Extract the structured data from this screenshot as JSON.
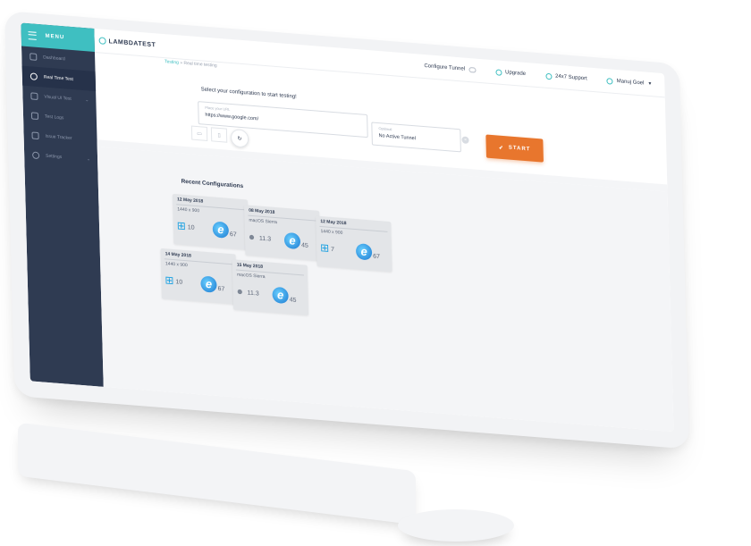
{
  "sidebar": {
    "menu_label": "MENU",
    "items": [
      {
        "label": "Dashboard"
      },
      {
        "label": "Real Time Test"
      },
      {
        "label": "Visual UI Test"
      },
      {
        "label": "Test Logs"
      },
      {
        "label": "Issue Tracker"
      },
      {
        "label": "Settings"
      }
    ]
  },
  "header": {
    "logo": "LAMBDATEST",
    "configure_tunnel": "Configure Tunnel",
    "upgrade": "Upgrade",
    "support": "24x7 Support",
    "user": "Manuj Goel"
  },
  "breadcrumb": {
    "root": "Testing",
    "separator": "»",
    "current": "Real time testing"
  },
  "config": {
    "title": "Select your configuration to start testing!",
    "url_label": "Place your URL",
    "url_value": "https://www.google.com/",
    "tunnel_label": "Optional",
    "tunnel_value": "No Active Tunnel",
    "clear_icon": "×",
    "start_label": "START"
  },
  "recent": {
    "title": "Recent Configurations",
    "cards": [
      {
        "date": "12 May 2018",
        "resolution": "1440 x 900",
        "os": "windows",
        "os_version": "10",
        "browser": "ie",
        "browser_version": "67"
      },
      {
        "date": "08 May 2018",
        "resolution": "macOS Sierra",
        "os": "apple",
        "os_version": "11.3",
        "browser": "ie",
        "browser_version": "45"
      },
      {
        "date": "12 May 2018",
        "resolution": "1440 x 900",
        "os": "windows",
        "os_version": "7",
        "browser": "ie",
        "browser_version": "67"
      },
      {
        "date": "14 May 2018",
        "resolution": "1440 x 900",
        "os": "windows",
        "os_version": "10",
        "browser": "ie",
        "browser_version": "67"
      },
      {
        "date": "15 May 2018",
        "resolution": "macOS Sierra",
        "os": "apple",
        "os_version": "11.3",
        "browser": "ie",
        "browser_version": "45"
      }
    ]
  },
  "colors": {
    "sidebar": "#2f3b52",
    "accent": "#3fbfc1",
    "start": "#e8762d"
  }
}
